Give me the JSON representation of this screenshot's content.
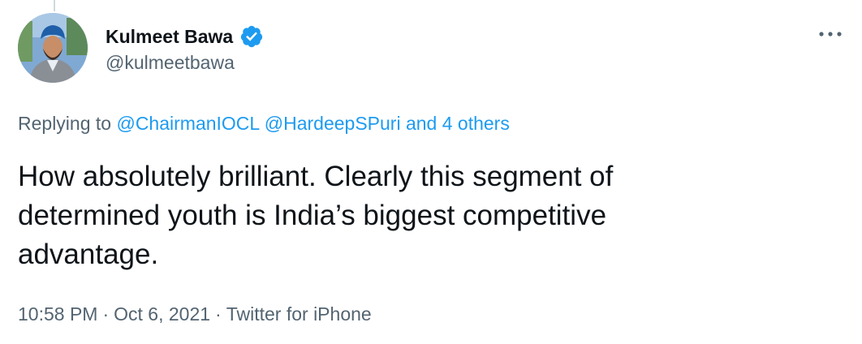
{
  "tweet": {
    "author": {
      "display_name": "Kulmeet Bawa",
      "handle": "@kulmeetbawa",
      "verified": true,
      "avatar_icon": "profile-photo"
    },
    "more_icon": "ellipsis-icon",
    "reply_context": {
      "prefix": "Replying to",
      "mentions": [
        "@ChairmanIOCL",
        "@HardeepSPuri"
      ],
      "others": "and 4 others"
    },
    "text_lines": [
      "How absolutely brilliant. Clearly this segment of",
      "determined youth is India’s biggest competitive",
      "advantage."
    ],
    "meta": {
      "time": "10:58 PM",
      "date": "Oct 6, 2021",
      "source": "Twitter for iPhone",
      "separator": "·"
    },
    "colors": {
      "link": "#1d9bf0",
      "secondary_text": "#536471",
      "primary_text": "#0f1419",
      "verified_badge": "#1d9bf0"
    }
  }
}
